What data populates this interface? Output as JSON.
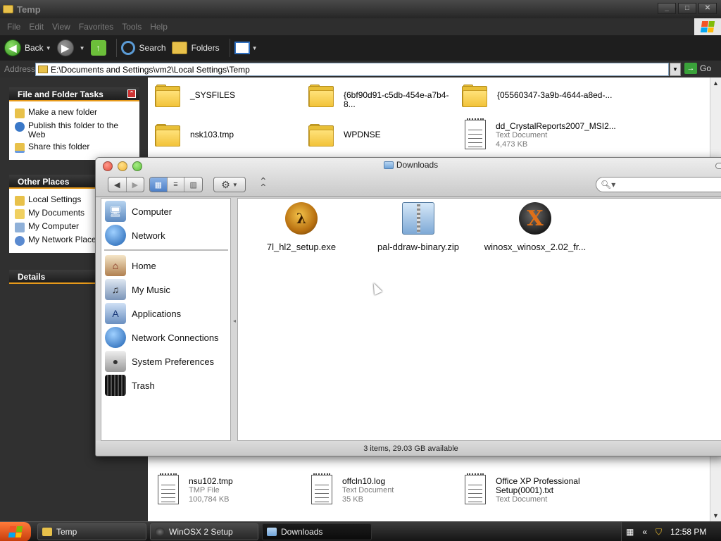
{
  "explorer": {
    "title": "Temp",
    "menu": [
      "File",
      "Edit",
      "View",
      "Favorites",
      "Tools",
      "Help"
    ],
    "toolbar": {
      "back": "Back",
      "search": "Search",
      "folders": "Folders"
    },
    "address": {
      "label": "Address",
      "path": "E:\\Documents and Settings\\vm2\\Local Settings\\Temp",
      "go": "Go"
    },
    "tasks": {
      "title": "File and Folder Tasks",
      "items": [
        "Make a new folder",
        "Publish this folder to the Web",
        "Share this folder"
      ]
    },
    "other_places": {
      "title": "Other Places",
      "items": [
        "Local Settings",
        "My Documents",
        "My Computer",
        "My Network Places"
      ]
    },
    "details": {
      "title": "Details"
    },
    "files": [
      {
        "name": "_SYSFILES"
      },
      {
        "name": "{6bf90d91-c5db-454e-a7b4-8..."
      },
      {
        "name": "{05560347-3a9b-4644-a8ed-..."
      },
      {
        "name": "nsk103.tmp"
      },
      {
        "name": "WPDNSE"
      },
      {
        "name": "dd_CrystalReports2007_MSI2...",
        "type": "Text Document",
        "size": "4,473 KB"
      },
      {
        "name": "nsu102.tmp",
        "type": "TMP File",
        "size": "100,784 KB"
      },
      {
        "name": "offcln10.log",
        "type": "Text Document",
        "size": "35 KB"
      },
      {
        "name": "Office XP Professional Setup(0001).txt",
        "type": "Text Document"
      }
    ]
  },
  "finder": {
    "title": "Downloads",
    "sidebar": [
      "Computer",
      "Network",
      "Home",
      "My Music",
      "Applications",
      "Network Connections",
      "System Preferences",
      "Trash"
    ],
    "files": [
      "7l_hl2_setup.exe",
      "pal-ddraw-binary.zip",
      "winosx_winosx_2.02_fr..."
    ],
    "status": "3 items, 29.03 GB available"
  },
  "taskbar": {
    "buttons": [
      "Temp",
      "WinOSX 2 Setup",
      "Downloads"
    ],
    "clock": "12:58 PM"
  },
  "colors": {
    "xp_accent": "#e79a1b",
    "mac_close": "#e24b3c",
    "mac_min": "#f2b637",
    "mac_zoom": "#5cc23a"
  }
}
